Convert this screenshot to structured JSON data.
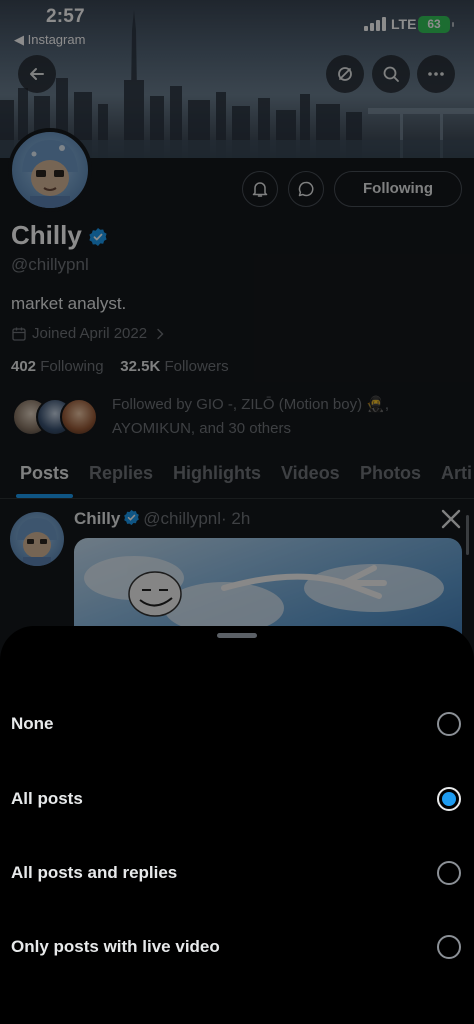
{
  "status_bar": {
    "time": "2:57",
    "back_app": "◀ Instagram",
    "network": "LTE",
    "battery": "63"
  },
  "profile": {
    "name": "Chilly",
    "handle": "@chillypnl",
    "bio": "market analyst.",
    "joined": "Joined April 2022",
    "following_count": "402",
    "following_label": "Following",
    "followers_count": "32.5K",
    "followers_label": "Followers",
    "follow_button": "Following",
    "followed_by": "Followed by GIO -, ZILŌ (Motion boy) 🥷, AYOMIKUN, and 30 others"
  },
  "tabs": [
    "Posts",
    "Replies",
    "Highlights",
    "Videos",
    "Photos",
    "Arti"
  ],
  "post": {
    "name": "Chilly",
    "handle": "@chillypnl",
    "time": "· 2h"
  },
  "sheet": {
    "options": [
      {
        "label": "None",
        "selected": false
      },
      {
        "label": "All posts",
        "selected": true
      },
      {
        "label": "All posts and replies",
        "selected": false
      },
      {
        "label": "Only posts with live video",
        "selected": false
      }
    ]
  },
  "colors": {
    "accent": "#1d9bf0",
    "background": "#000000",
    "battery": "#34c759"
  }
}
